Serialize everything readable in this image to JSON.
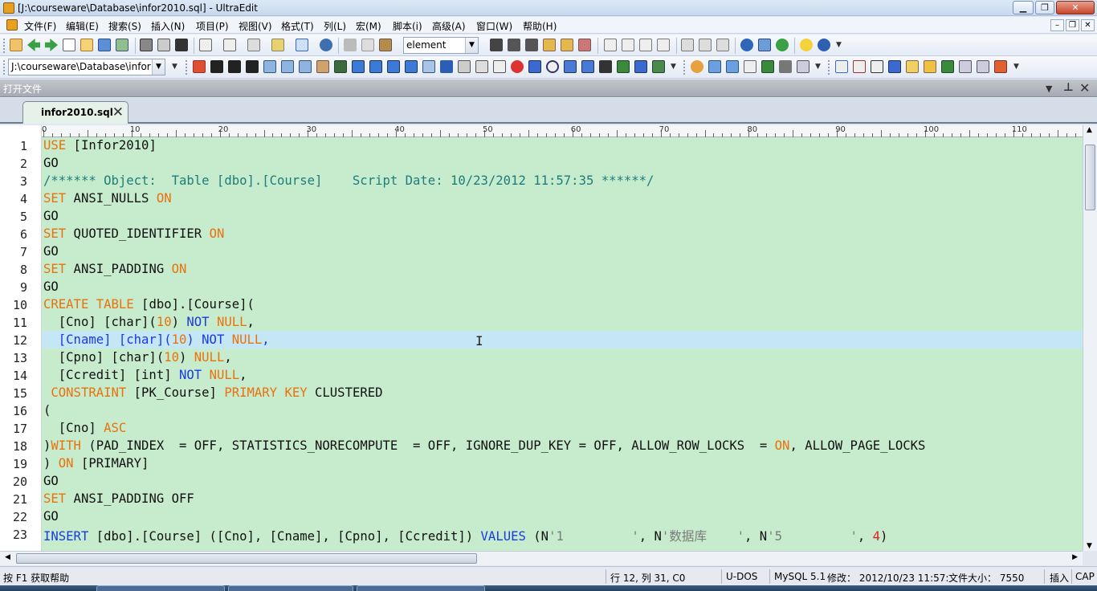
{
  "window": {
    "title": "[J:\\courseware\\Database\\infor2010.sql] - UltraEdit",
    "min_label": "▁",
    "max_label": "❐",
    "close_label": "✕"
  },
  "menu": {
    "items": [
      "文件(F)",
      "编辑(E)",
      "搜索(S)",
      "插入(N)",
      "项目(P)",
      "视图(V)",
      "格式(T)",
      "列(L)",
      "宏(M)",
      "脚本(i)",
      "高级(A)",
      "窗口(W)",
      "帮助(H)"
    ],
    "mdi_min": "–",
    "mdi_restore": "❐",
    "mdi_close": "✕"
  },
  "toolbar1": {
    "combo_value": "element"
  },
  "toolbar2": {
    "path_combo_value": "J:\\courseware\\Database\\infor"
  },
  "panel": {
    "title": "打开文件"
  },
  "tabs": [
    {
      "label": "infor2010.sql",
      "close": "✕"
    }
  ],
  "ruler": {
    "labels": [
      "0",
      "10",
      "20",
      "30",
      "40",
      "50",
      "60",
      "70",
      "80",
      "90",
      "100",
      "110"
    ]
  },
  "editor": {
    "line_numbers": [
      "1",
      "2",
      "3",
      "4",
      "5",
      "6",
      "7",
      "8",
      "9",
      "10",
      "11",
      "12",
      "13",
      "14",
      "15",
      "16",
      "17",
      "18",
      "19",
      "20",
      "21",
      "22",
      "23"
    ],
    "current_line": 12,
    "lines": [
      [
        {
          "t": "USE",
          "c": "kw"
        },
        {
          "t": " [Infor2010]",
          "c": ""
        }
      ],
      [
        {
          "t": "GO",
          "c": ""
        }
      ],
      [
        {
          "t": "/****** Object:  Table [dbo].[Course]    Script Date: 10/23/2012 11:57:35 ******/",
          "c": "cm"
        }
      ],
      [
        {
          "t": "SET",
          "c": "kw"
        },
        {
          "t": " ANSI_NULLS ",
          "c": ""
        },
        {
          "t": "ON",
          "c": "kw"
        }
      ],
      [
        {
          "t": "GO",
          "c": ""
        }
      ],
      [
        {
          "t": "SET",
          "c": "kw"
        },
        {
          "t": " QUOTED_IDENTIFIER ",
          "c": ""
        },
        {
          "t": "ON",
          "c": "kw"
        }
      ],
      [
        {
          "t": "GO",
          "c": ""
        }
      ],
      [
        {
          "t": "SET",
          "c": "kw"
        },
        {
          "t": " ANSI_PADDING ",
          "c": ""
        },
        {
          "t": "ON",
          "c": "kw"
        }
      ],
      [
        {
          "t": "GO",
          "c": ""
        }
      ],
      [
        {
          "t": "CREATE TABLE",
          "c": "kw"
        },
        {
          "t": " [dbo].[Course](",
          "c": ""
        }
      ],
      [
        {
          "t": "  [Cno] [char](",
          "c": ""
        },
        {
          "t": "10",
          "c": "kw"
        },
        {
          "t": ") ",
          "c": ""
        },
        {
          "t": "NOT",
          "c": "kb"
        },
        {
          "t": " ",
          "c": ""
        },
        {
          "t": "NULL",
          "c": "kw"
        },
        {
          "t": ",",
          "c": ""
        }
      ],
      [
        {
          "t": "  [Cname] [char](",
          "c": "cur"
        },
        {
          "t": "10",
          "c": "kw"
        },
        {
          "t": ") ",
          "c": "cur"
        },
        {
          "t": "NOT",
          "c": "kb"
        },
        {
          "t": " ",
          "c": ""
        },
        {
          "t": "NULL",
          "c": "kw"
        },
        {
          "t": ",",
          "c": "cur"
        }
      ],
      [
        {
          "t": "  [Cpno] [char](",
          "c": ""
        },
        {
          "t": "10",
          "c": "kw"
        },
        {
          "t": ") ",
          "c": ""
        },
        {
          "t": "NULL",
          "c": "kw"
        },
        {
          "t": ",",
          "c": ""
        }
      ],
      [
        {
          "t": "  [Ccredit] [int] ",
          "c": ""
        },
        {
          "t": "NOT",
          "c": "kb"
        },
        {
          "t": " ",
          "c": ""
        },
        {
          "t": "NULL",
          "c": "kw"
        },
        {
          "t": ",",
          "c": ""
        }
      ],
      [
        {
          "t": " ",
          "c": ""
        },
        {
          "t": "CONSTRAINT",
          "c": "kw"
        },
        {
          "t": " [PK_Course] ",
          "c": ""
        },
        {
          "t": "PRIMARY KEY",
          "c": "kw"
        },
        {
          "t": " CLUSTERED",
          "c": ""
        }
      ],
      [
        {
          "t": "(",
          "c": ""
        }
      ],
      [
        {
          "t": "  [Cno] ",
          "c": ""
        },
        {
          "t": "ASC",
          "c": "kw"
        }
      ],
      [
        {
          "t": ")",
          "c": ""
        },
        {
          "t": "WITH",
          "c": "kw"
        },
        {
          "t": " (PAD_INDEX  = OFF, STATISTICS_NORECOMPUTE  = OFF, IGNORE_DUP_KEY = OFF, ALLOW_ROW_LOCKS  = ",
          "c": ""
        },
        {
          "t": "ON",
          "c": "kw"
        },
        {
          "t": ", ALLOW_PAGE_LOCKS",
          "c": ""
        }
      ],
      [
        {
          "t": ") ",
          "c": ""
        },
        {
          "t": "ON",
          "c": "kw"
        },
        {
          "t": " [PRIMARY]",
          "c": ""
        }
      ],
      [
        {
          "t": "GO",
          "c": ""
        }
      ],
      [
        {
          "t": "SET",
          "c": "kw"
        },
        {
          "t": " ANSI_PADDING OFF",
          "c": ""
        }
      ],
      [
        {
          "t": "GO",
          "c": ""
        }
      ],
      [
        {
          "t": "INSERT",
          "c": "kb"
        },
        {
          "t": " [dbo].[Course] ([Cno], [Cname], [Cpno], [Ccredit]) ",
          "c": ""
        },
        {
          "t": "VALUES",
          "c": "kb"
        },
        {
          "t": " (N",
          "c": ""
        },
        {
          "t": "'1         '",
          "c": "st"
        },
        {
          "t": ", N",
          "c": ""
        },
        {
          "t": "'数据库    '",
          "c": "st"
        },
        {
          "t": ", N",
          "c": ""
        },
        {
          "t": "'5         '",
          "c": "st"
        },
        {
          "t": ", ",
          "c": ""
        },
        {
          "t": "4",
          "c": "nm"
        },
        {
          "t": ")",
          "c": ""
        }
      ]
    ]
  },
  "statusbar": {
    "help": "按 F1 获取帮助",
    "position": "行 12, 列 31, C0",
    "encoding": "U-DOS",
    "syntax": "MySQL 5.1",
    "modified": "修改： 2012/10/23 11:57:",
    "filesize": "文件大小： 7550",
    "insert_mode": "插入",
    "caps": "CAP"
  }
}
